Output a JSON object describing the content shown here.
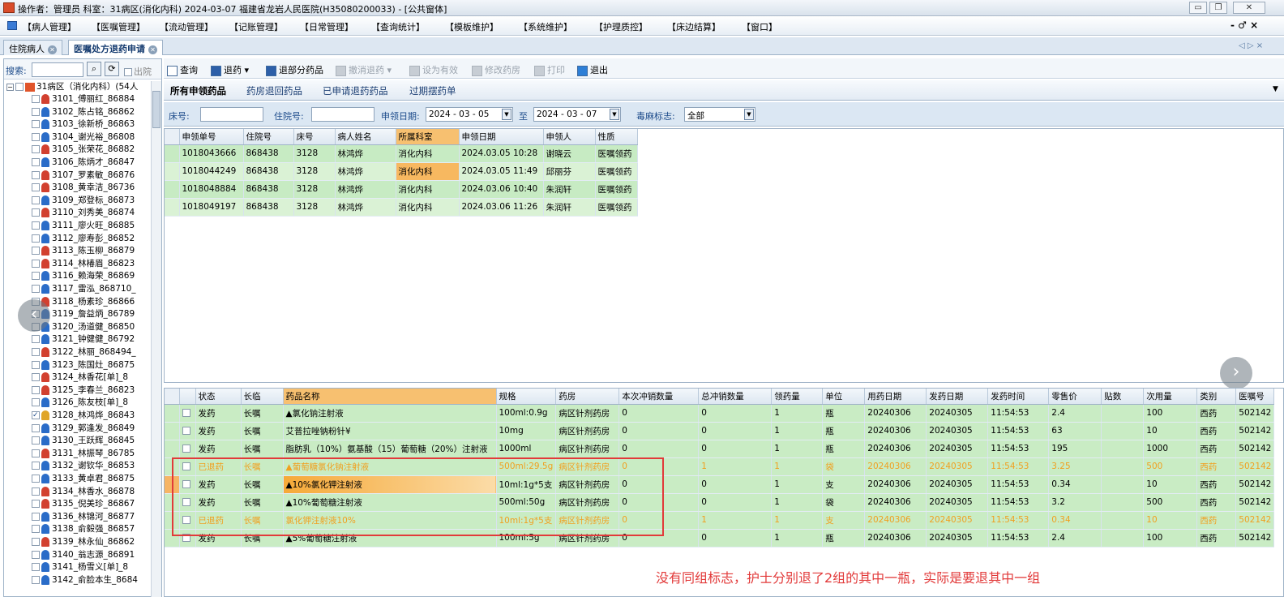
{
  "window": {
    "title": "操作者：管理员 科室：31病区(消化内科) 2024-03-07 福建省龙岩人民医院(H35080200033) - [公共窗体]"
  },
  "menu": {
    "items": [
      "【病人管理】",
      "【医嘱管理】",
      "【流动管理】",
      "【记账管理】",
      "【日常管理】",
      "【查询统计】",
      "【模板维护】",
      "【系统维护】",
      "【护理质控】",
      "【床边结算】",
      "【窗口】"
    ],
    "right_controls": "- ♂ ×"
  },
  "tabs": [
    {
      "label": "住院病人"
    },
    {
      "label": "医嘱处方退药申请"
    }
  ],
  "tab_nav": "◁ ▷ ×",
  "left_panel": {
    "search_label": "搜索:",
    "discharged_label": "出院",
    "root_label": "31病区（消化内科）(54人",
    "patients": [
      {
        "label": "3101_傅丽红_86884",
        "icon": "female"
      },
      {
        "label": "3102_陈占铭_86862",
        "icon": "male"
      },
      {
        "label": "3103_徐新桥_86863",
        "icon": "male"
      },
      {
        "label": "3104_谢光裕_86808",
        "icon": "male"
      },
      {
        "label": "3105_张荣花_86882",
        "icon": "female"
      },
      {
        "label": "3106_陈炳才_86847",
        "icon": "male"
      },
      {
        "label": "3107_罗素敏_86876",
        "icon": "female"
      },
      {
        "label": "3108_黄幸洁_86736",
        "icon": "female"
      },
      {
        "label": "3109_郑登标_86873",
        "icon": "male"
      },
      {
        "label": "3110_刘秀美_86874",
        "icon": "female"
      },
      {
        "label": "3111_廖火旺_86885",
        "icon": "male"
      },
      {
        "label": "3112_廖寿彭_86852",
        "icon": "male"
      },
      {
        "label": "3113_陈玉柳_86879",
        "icon": "female"
      },
      {
        "label": "3114_林椿眉_86823",
        "icon": "female"
      },
      {
        "label": "3116_赖海荣_86869",
        "icon": "male"
      },
      {
        "label": "3117_雷泓_868710_",
        "icon": "male"
      },
      {
        "label": "3118_杨素珍_86866",
        "icon": "female"
      },
      {
        "label": "3119_詹益炳_86789",
        "icon": "male"
      },
      {
        "label": "3120_汤道健_86850",
        "icon": "male"
      },
      {
        "label": "3121_钟健健_86792",
        "icon": "male"
      },
      {
        "label": "3122_林丽_868494_",
        "icon": "female"
      },
      {
        "label": "3123_陈国灶_86875",
        "icon": "male"
      },
      {
        "label": "3124_林香花[单]_8",
        "icon": "female"
      },
      {
        "label": "3125_李春兰_86823",
        "icon": "female"
      },
      {
        "label": "3126_陈友枝[单]_8",
        "icon": "male"
      },
      {
        "label": "3128_林鸿烨_86843",
        "icon": "checked"
      },
      {
        "label": "3129_郭逢发_86849",
        "icon": "male"
      },
      {
        "label": "3130_王跃辉_86845",
        "icon": "male"
      },
      {
        "label": "3131_林振琴_86785",
        "icon": "female"
      },
      {
        "label": "3132_谢钦华_86853",
        "icon": "male"
      },
      {
        "label": "3133_黄卓君_86875",
        "icon": "male"
      },
      {
        "label": "3134_林香水_86878",
        "icon": "female"
      },
      {
        "label": "3135_倪美珍_86867",
        "icon": "female"
      },
      {
        "label": "3136_林锦河_86877",
        "icon": "male"
      },
      {
        "label": "3138_俞毅强_86857",
        "icon": "male"
      },
      {
        "label": "3139_林永仙_86862",
        "icon": "female"
      },
      {
        "label": "3140_翁志源_86891",
        "icon": "male"
      },
      {
        "label": "3141_杨雪义[单]_8",
        "icon": "male"
      },
      {
        "label": "3142_俞脸本生_8684",
        "icon": "male"
      }
    ]
  },
  "toolbar": {
    "query": "查询",
    "return": "退药",
    "partial_return": "退部分药品",
    "cancel_return": "撤消退药",
    "set_valid": "设为有效",
    "modify_pharmacy": "修改药房",
    "print": "打印",
    "exit": "退出"
  },
  "subtabs": [
    "所有申领药品",
    "药房退回药品",
    "已申请退药药品",
    "过期摆药单"
  ],
  "filter": {
    "bed_label": "床号:",
    "bed_value": "",
    "admission_label": "住院号:",
    "admission_value": "",
    "date_label": "申领日期:",
    "date_from": "2024 - 03 - 05",
    "to_label": "至",
    "date_to": "2024 - 03 - 07",
    "narcotic_label": "毒麻标志:",
    "narcotic_value": "全部"
  },
  "grid1": {
    "columns": [
      "申领单号",
      "住院号",
      "床号",
      "病人姓名",
      "所属科室",
      "申领日期",
      "申领人",
      "性质"
    ],
    "rows": [
      [
        "1018043666",
        "868438",
        "3128",
        "林鸿烨",
        "消化内科",
        "2024.03.05 10:28",
        "谢晓云",
        "医嘱领药"
      ],
      [
        "1018044249",
        "868438",
        "3128",
        "林鸿烨",
        "消化内科",
        "2024.03.05 11:49",
        "邱丽芬",
        "医嘱领药"
      ],
      [
        "1018048884",
        "868438",
        "3128",
        "林鸿烨",
        "消化内科",
        "2024.03.06 10:40",
        "朱润轩",
        "医嘱领药"
      ],
      [
        "1018049197",
        "868438",
        "3128",
        "林鸿烨",
        "消化内科",
        "2024.03.06 11:26",
        "朱润轩",
        "医嘱领药"
      ]
    ]
  },
  "grid2": {
    "columns": [
      "状态",
      "长临",
      "药品名称",
      "规格",
      "药房",
      "本次冲销数量",
      "总冲销数量",
      "领药量",
      "单位",
      "用药日期",
      "发药日期",
      "发药时间",
      "零售价",
      "贴数",
      "次用量",
      "类别",
      "医嘱号"
    ],
    "rows": [
      [
        "发药",
        "长嘱",
        "▲氯化钠注射液",
        "100ml:0.9g",
        "病区针剂药房",
        "0",
        "0",
        "1",
        "瓶",
        "20240306",
        "20240305",
        "11:54:53",
        "2.4",
        "",
        "100",
        "西药",
        "502142"
      ],
      [
        "发药",
        "长嘱",
        "艾普拉唑钠粉针¥",
        "10mg",
        "病区针剂药房",
        "0",
        "0",
        "1",
        "瓶",
        "20240306",
        "20240305",
        "11:54:53",
        "63",
        "",
        "10",
        "西药",
        "502142"
      ],
      [
        "发药",
        "长嘱",
        "脂肪乳（10%）氨基酸（15）葡萄糖（20%）注射液",
        "1000ml",
        "病区针剂药房",
        "0",
        "0",
        "1",
        "瓶",
        "20240306",
        "20240305",
        "11:54:53",
        "195",
        "",
        "1000",
        "西药",
        "502142"
      ],
      [
        "已退药",
        "长嘱",
        "▲葡萄糖氯化钠注射液",
        "500ml:29.5g",
        "病区针剂药房",
        "0",
        "1",
        "1",
        "袋",
        "20240306",
        "20240305",
        "11:54:53",
        "3.25",
        "",
        "500",
        "西药",
        "502142"
      ],
      [
        "发药",
        "长嘱",
        "▲10%氯化钾注射液",
        "10ml:1g*5支",
        "病区针剂药房",
        "0",
        "0",
        "1",
        "支",
        "20240306",
        "20240305",
        "11:54:53",
        "0.34",
        "",
        "10",
        "西药",
        "502142"
      ],
      [
        "发药",
        "长嘱",
        "▲10%葡萄糖注射液",
        "500ml:50g",
        "病区针剂药房",
        "0",
        "0",
        "1",
        "袋",
        "20240306",
        "20240305",
        "11:54:53",
        "3.2",
        "",
        "500",
        "西药",
        "502142"
      ],
      [
        "已退药",
        "长嘱",
        "氯化钾注射液10%",
        "10ml:1g*5支",
        "病区针剂药房",
        "0",
        "1",
        "1",
        "支",
        "20240306",
        "20240305",
        "11:54:53",
        "0.34",
        "",
        "10",
        "西药",
        "502142"
      ],
      [
        "发药",
        "长嘱",
        "▲5%葡萄糖注射液",
        "100ml:5g",
        "病区针剂药房",
        "0",
        "0",
        "1",
        "瓶",
        "20240306",
        "20240305",
        "11:54:53",
        "2.4",
        "",
        "100",
        "西药",
        "502142"
      ]
    ]
  },
  "annotation": "没有同组标志，护士分别退了2组的其中一瓶，实际是要退其中一组",
  "colors": {
    "returned_text": "#f0a020",
    "annotation_red": "#e23a3a",
    "row_green": "#c9ecc4",
    "highlight_orange": "#f7b860"
  }
}
